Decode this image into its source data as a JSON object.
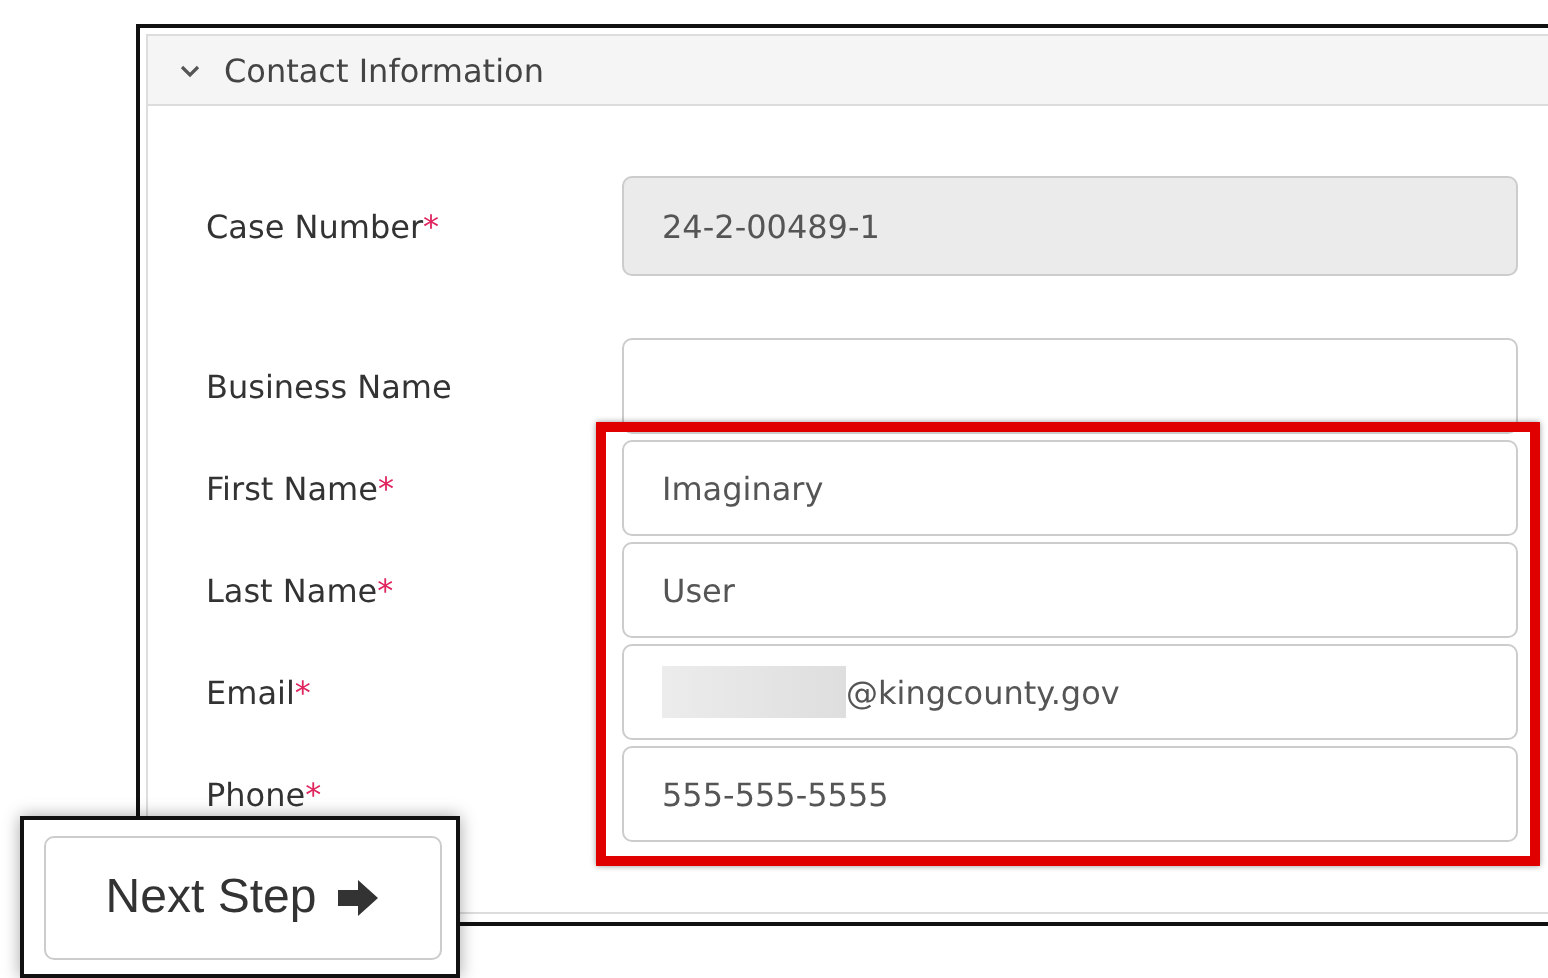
{
  "section": {
    "title": "Contact Information",
    "expanded": true
  },
  "fields": [
    {
      "label": "Case Number",
      "required_mark": "*",
      "value": "24-2-00489-1",
      "disabled": true
    },
    {
      "label": "Business Name",
      "disabled": false
    }
  ],
  "highlight_group": {
    "fields": [
      {
        "label": "First Name",
        "required_mark": "*",
        "value": "Imaginary",
        "disabled": false
      },
      {
        "label": "Last Name",
        "required_mark": "*",
        "value": "User",
        "disabled": false
      },
      {
        "label": "Email",
        "required_mark": "*",
        "value": "@kingcounty.gov",
        "redacted_prefix": true,
        "disabled": false
      },
      {
        "label": "Phone",
        "required_mark": "*",
        "value": "555-555-5555",
        "disabled": false
      }
    ]
  },
  "next_button": {
    "label": "Next Step"
  }
}
